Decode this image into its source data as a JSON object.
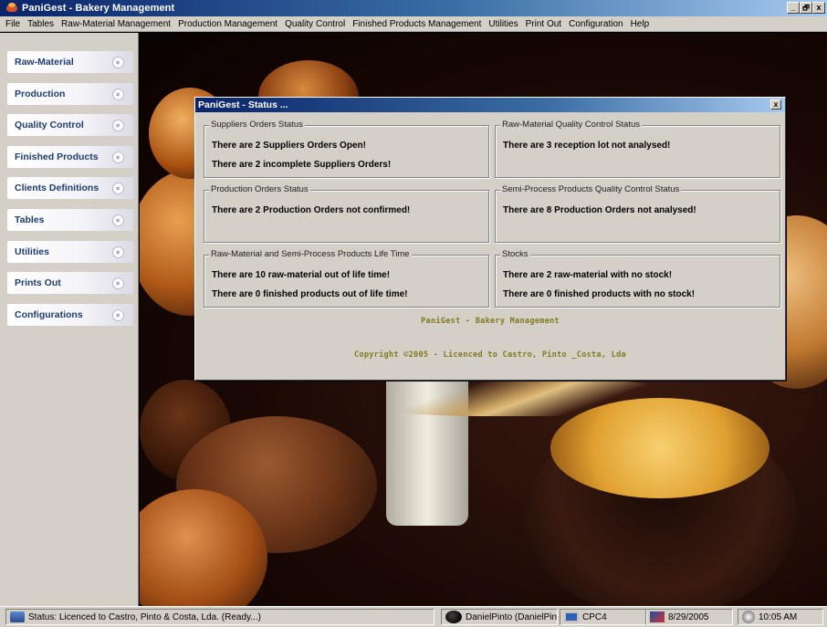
{
  "window": {
    "title": "PaniGest - Bakery Management",
    "controls": [
      "_",
      "🗗",
      "x"
    ]
  },
  "menu": [
    "File",
    "Tables",
    "Raw-Material Management",
    "Production Management",
    "Quality Control",
    "Finished Products Management",
    "Utilities",
    "Print Out",
    "Configuration",
    "Help"
  ],
  "sidebar": {
    "items": [
      {
        "label": "Raw-Material"
      },
      {
        "label": "Production"
      },
      {
        "label": "Quality Control"
      },
      {
        "label": "Finished Products"
      },
      {
        "label": "Clients Definitions"
      },
      {
        "label": "Tables"
      },
      {
        "label": "Utilities"
      },
      {
        "label": "Prints Out"
      },
      {
        "label": "Configurations"
      }
    ],
    "chevron_glyph": "»"
  },
  "dialog": {
    "title": "PaniGest - Status ...",
    "close": "x",
    "groups": [
      {
        "label": "Suppliers Orders Status",
        "lines": [
          "There are 2 Suppliers Orders Open!",
          "There are 2 incomplete Suppliers Orders!"
        ]
      },
      {
        "label": "Raw-Material Quality Control Status",
        "lines": [
          "There are 3 reception lot not analysed!"
        ]
      },
      {
        "label": "Production Orders Status",
        "lines": [
          "There are 2 Production Orders not confirmed!"
        ]
      },
      {
        "label": "Semi-Process Products Quality Control Status",
        "lines": [
          "There are 8 Production Orders not analysed!"
        ]
      },
      {
        "label": "Raw-Material and Semi-Process Products Life Time",
        "lines": [
          "There are 10 raw-material out of life time!",
          "There are 0 finished products out of life time!"
        ]
      },
      {
        "label": "Stocks",
        "lines": [
          "There are 2 raw-material with no stock!",
          "There are 0 finished products with no stock!"
        ]
      }
    ],
    "footer_app": "PaniGest - Bakery Management",
    "footer_copyright": "Copyright ©2005 - Licenced to Castro, Pinto _Costa, Lda"
  },
  "statusbar": {
    "status": "Status: Licenced to Castro, Pinto & Costa, Lda. (Ready...)",
    "user": "DanielPinto (DanielPint",
    "computer": "CPC4",
    "date": "8/29/2005",
    "time": "10:05 AM"
  },
  "colors": {
    "titlebar": "#0a246a",
    "sidebar_label": "#1e3c6e",
    "footer_text": "#807a20",
    "window_face": "#d4d0c8"
  }
}
